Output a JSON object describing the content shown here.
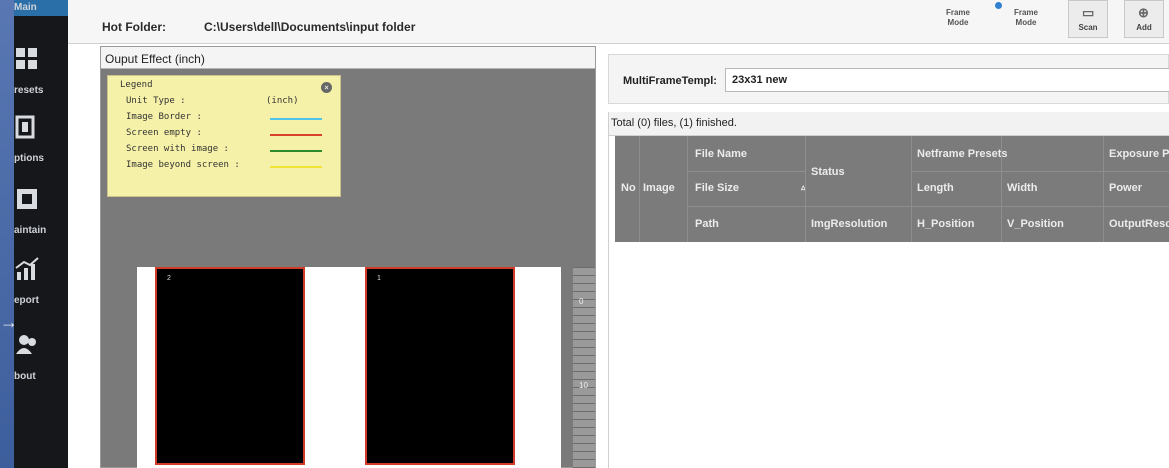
{
  "sidebar": {
    "items": [
      {
        "label": "Main",
        "icon": "main-icon"
      },
      {
        "label": "resets",
        "icon": "presets-icon"
      },
      {
        "label": "ptions",
        "icon": "options-icon"
      },
      {
        "label": "aintain",
        "icon": "maintain-icon"
      },
      {
        "label": "eport",
        "icon": "report-icon"
      },
      {
        "label": "bout",
        "icon": "about-icon"
      }
    ],
    "arrow": "→"
  },
  "header": {
    "hot_folder_label": "Hot Folder:",
    "hot_folder_path": "C:\\Users\\dell\\Documents\\input folder",
    "mode1": "Frame\nMode",
    "mode2": "Frame\nMode",
    "scan_label": "Scan",
    "add_label": "Add"
  },
  "output": {
    "title": "Ouput Effect   (inch)",
    "legend": {
      "title": "Legend",
      "rows": [
        {
          "text": "Unit Type :",
          "value": "(inch)"
        },
        {
          "text": "Image Border :",
          "color": "#4fc3e8"
        },
        {
          "text": "Screen empty :",
          "color": "#d9432e"
        },
        {
          "text": "Screen with image :",
          "color": "#2b8a2b"
        },
        {
          "text": "Image beyond screen :",
          "color": "#f1e238"
        }
      ],
      "close": "×"
    },
    "frames": [
      {
        "num": "2"
      },
      {
        "num": "1"
      }
    ],
    "ruler_marks": [
      "0",
      "10"
    ]
  },
  "right": {
    "mft_label": "MultiFrameTempl:",
    "mft_value": "23x31 new",
    "total": "Total (0) files, (1) finished.",
    "headers": {
      "no": "No",
      "image": "Image",
      "file_name": "File Name",
      "file_size": "File Size",
      "sort": "▵",
      "path": "Path",
      "status": "Status",
      "img_resolution": "ImgResolution",
      "netframe_presets": "Netframe Presets",
      "length": "Length",
      "width": "Width",
      "h_position": "H_Position",
      "v_position": "V_Position",
      "exposure": "Exposure P",
      "power": "Power",
      "output_res": "OutputReso"
    }
  }
}
